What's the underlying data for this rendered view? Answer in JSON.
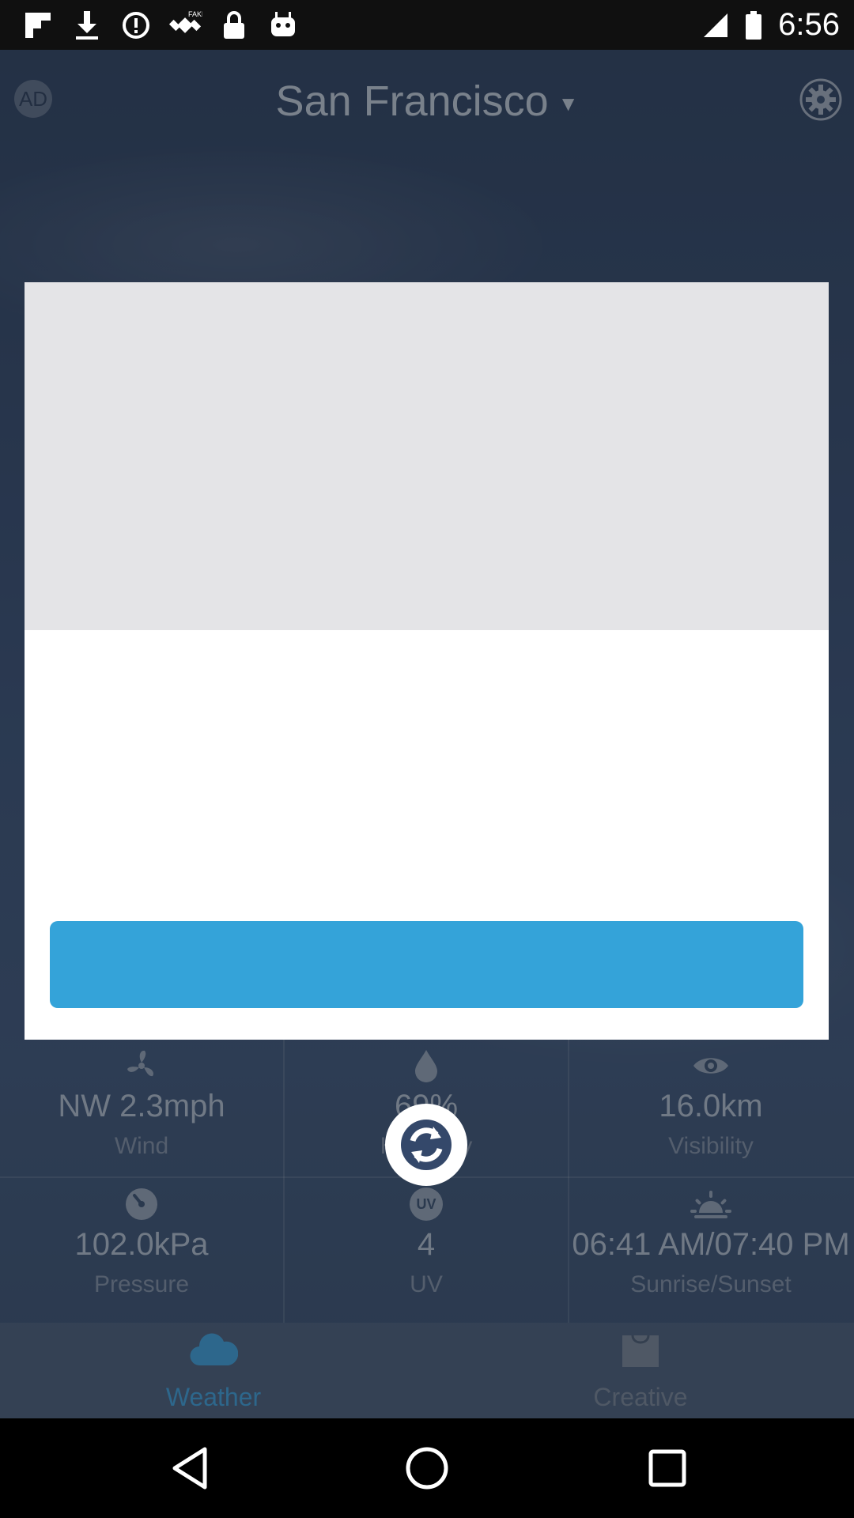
{
  "status_bar": {
    "time": "6:56",
    "icons": [
      "flipboard-icon",
      "download-icon",
      "data-saver-icon",
      "fake-gps-icon",
      "lock-icon",
      "android-icon"
    ]
  },
  "header": {
    "ad_badge": "AD",
    "city": "San Francisco",
    "caret": "▼"
  },
  "weather": {
    "wind": {
      "value": "NW 2.3mph",
      "label": "Wind"
    },
    "humidity": {
      "value": "69%",
      "label": "Humidity"
    },
    "visibility": {
      "value": "16.0km",
      "label": "Visibility"
    },
    "pressure": {
      "value": "102.0kPa",
      "label": "Pressure"
    },
    "uv": {
      "value": "4",
      "label": "UV",
      "icon_text": "UV"
    },
    "sun": {
      "value": "06:41 AM/07:40 PM",
      "label": "Sunrise/Sunset"
    }
  },
  "bottom_nav": {
    "weather_label": "Weather",
    "creative_label": "Creative",
    "active_color": "#3fa3de",
    "inactive_color": "#7c8797"
  },
  "modal": {
    "media_color": "#e4e4e7",
    "cta_color": "#34a3d9"
  }
}
